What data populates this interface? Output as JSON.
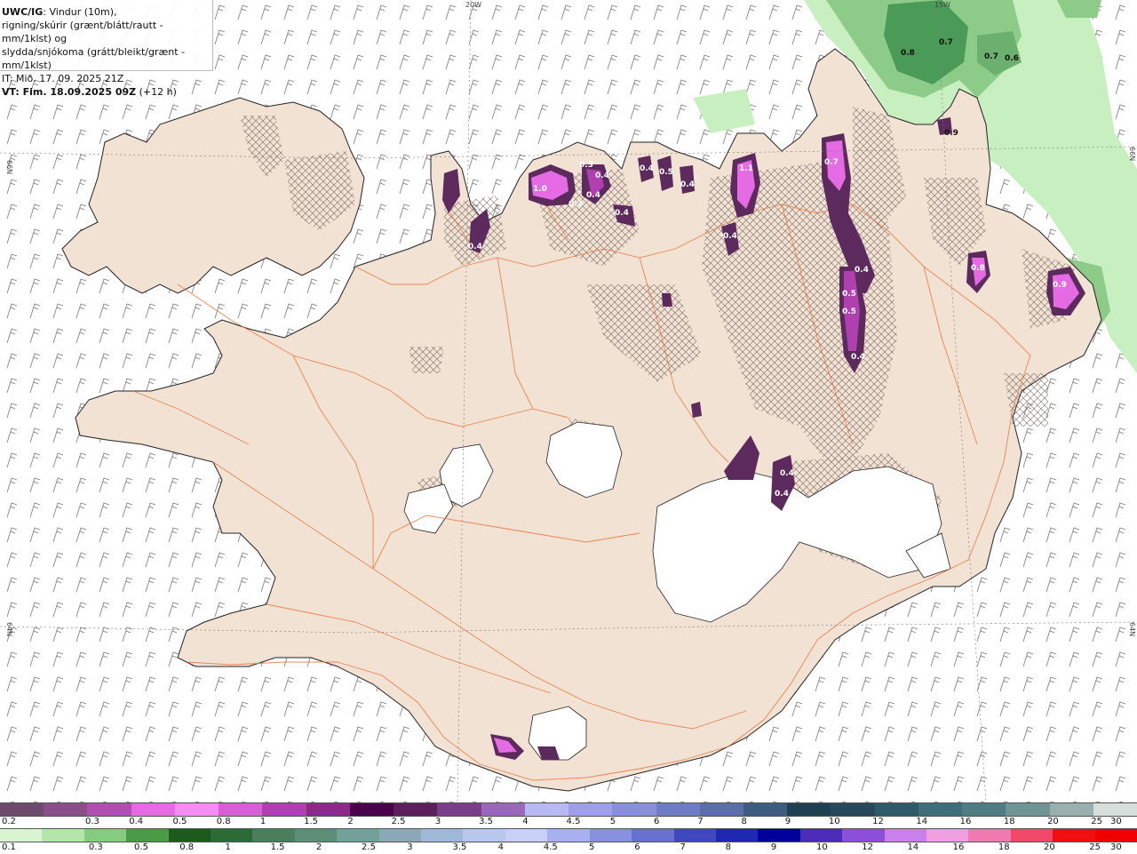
{
  "header": {
    "product": "UWC/IG",
    "line1_rest": ": Vindur (10m),",
    "line2": "rigning/skúrir (grænt/blátt/rautt - mm/1klst) og",
    "line3": "slydda/snjókoma (grátt/bleikt/grænt - mm/1klst)",
    "line4": "IT: Mið. 17. 09. 2025 21Z",
    "line5_bold": "VT: Fim. 18.09.2025 09Z",
    "line5_rest": " (+12 h)"
  },
  "grid_labels": {
    "lon_20w": "20W",
    "lon_15w": "15W",
    "lat_66n_left": "66N",
    "lat_66n_right": "66N",
    "lat_64n_left": "64N",
    "lat_64n_right": "64N"
  },
  "map_labels": [
    {
      "text": "1.0",
      "kind": "snow",
      "pos": "[603,211]"
    },
    {
      "text": "0.3",
      "kind": "snow"
    },
    {
      "text": "0.4",
      "kind": "snow"
    },
    {
      "text": "0.3",
      "kind": "snow"
    },
    {
      "text": "0.4",
      "kind": "snow"
    },
    {
      "text": "0.4",
      "kind": "snow"
    },
    {
      "text": "0.4",
      "kind": "snow"
    },
    {
      "text": "0.5",
      "kind": "snow"
    },
    {
      "text": "0.4",
      "kind": "snow"
    },
    {
      "text": "0.4",
      "kind": "snow"
    },
    {
      "text": "1.1",
      "kind": "snow"
    },
    {
      "text": "0.4",
      "kind": "snow"
    },
    {
      "text": "0.7",
      "kind": "snow"
    },
    {
      "text": "0.4",
      "kind": "snow"
    },
    {
      "text": "0.5",
      "kind": "snow"
    },
    {
      "text": "0.5",
      "kind": "snow"
    },
    {
      "text": "0.4",
      "kind": "snow"
    },
    {
      "text": "0.8",
      "kind": "snow"
    },
    {
      "text": "0.9",
      "kind": "snow"
    },
    {
      "text": "0.4",
      "kind": "snow"
    },
    {
      "text": "0.4",
      "kind": "snow"
    },
    {
      "text": "0.8",
      "kind": "rain"
    },
    {
      "text": "0.7",
      "kind": "rain"
    },
    {
      "text": "0.7",
      "kind": "rain"
    },
    {
      "text": "0.6",
      "kind": "rain"
    },
    {
      "text": "0.9",
      "kind": "rain"
    }
  ],
  "legend_snow": {
    "colors": [
      "#6e4a6e",
      "#8a4f8a",
      "#b04fb0",
      "#e46be4",
      "#f48cf4",
      "#d65fd6",
      "#b03fb0",
      "#8c2a8c",
      "#4a004a",
      "#5c1f5c",
      "#7a3d8a",
      "#9a68b8",
      "#b8b8f4",
      "#9f9fe8",
      "#8a90d8",
      "#6e7cc4",
      "#5c6ea8",
      "#3e5c80",
      "#1e4050",
      "#264a5c",
      "#2e5a6a",
      "#3e6e78",
      "#4e7e84",
      "#6e9494",
      "#9ab0ae",
      "#d6dfdc"
    ],
    "labels": [
      "0.2",
      "0.3",
      "0.4",
      "0.5",
      "0.8",
      "1",
      "1.5",
      "2",
      "2.5",
      "3",
      "3.5",
      "4",
      "4.5",
      "5",
      "6",
      "7",
      "8",
      "9",
      "10",
      "12",
      "14",
      "16",
      "18",
      "20",
      "25",
      "30"
    ]
  },
  "legend_rain": {
    "colors": [
      "#d8f4d0",
      "#b4e6ac",
      "#86cc80",
      "#4a9a48",
      "#1e5a1e",
      "#2e6a36",
      "#4a7e5c",
      "#5e8e78",
      "#74a09a",
      "#8aa8b8",
      "#a0b8d8",
      "#b8c8ec",
      "#c8d0f8",
      "#a8b0f0",
      "#8890e0",
      "#6870d0",
      "#4048c0",
      "#1e28b0",
      "#00009a",
      "#4a2cb8",
      "#8c50d8",
      "#c880ec",
      "#f0a0e0",
      "#f07ab0",
      "#f04868",
      "#f01010",
      "#f00000"
    ],
    "labels": [
      "0.1",
      "0.3",
      "0.5",
      "0.8",
      "1",
      "1.5",
      "2",
      "2.5",
      "3",
      "3.5",
      "4",
      "4.5",
      "5",
      "6",
      "7",
      "8",
      "9",
      "10",
      "12",
      "14",
      "16",
      "18",
      "20",
      "25",
      "30"
    ]
  },
  "colors": {
    "land": "#f2e2d4",
    "roads": "#e8743a",
    "coast": "#222222",
    "glacier": "#ffffff",
    "snow_light": "#e46be4",
    "snow_mid": "#b03fb0",
    "snow_dark": "#5c2a5c",
    "rain_light": "#c8efc0",
    "rain_mid": "#8ccc88",
    "rain_dark": "#4a9a58"
  }
}
